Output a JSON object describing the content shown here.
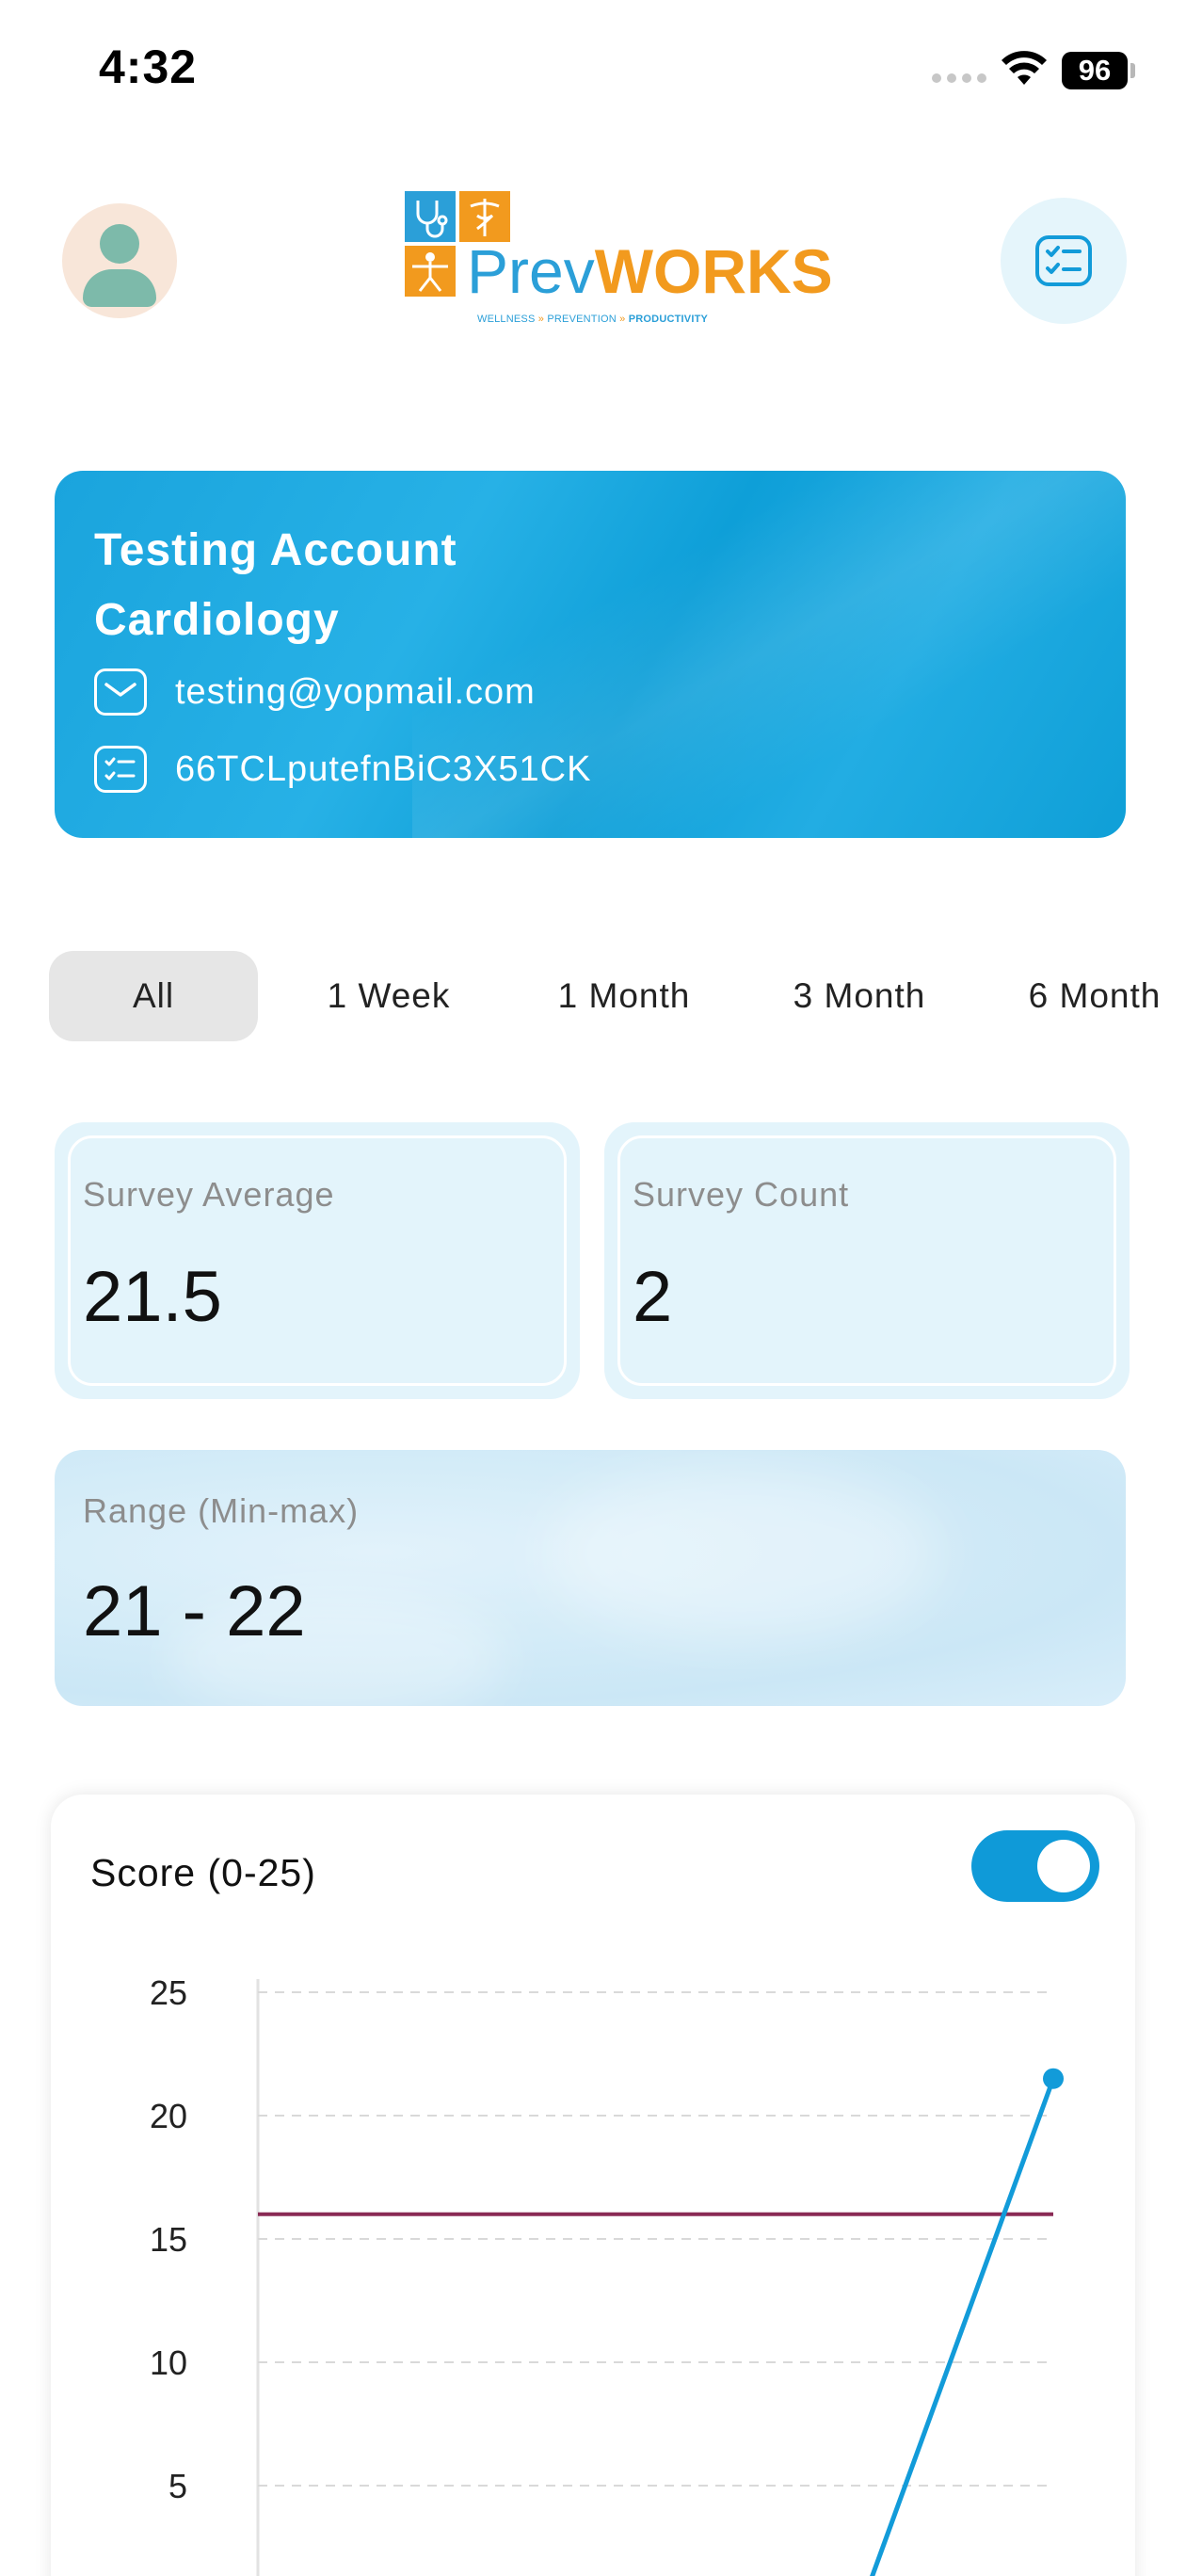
{
  "status_bar": {
    "time": "4:32",
    "battery": "96"
  },
  "header": {
    "logo": {
      "prev": "Prev",
      "works": "WORKS",
      "tagline": [
        "WELLNESS",
        "PREVENTION",
        "PRODUCTIVITY"
      ],
      "tagline_sep": "»"
    },
    "icons": {
      "avatar": "user-avatar",
      "survey": "checklist-icon"
    }
  },
  "account": {
    "name": "Testing Account Cardiology",
    "email": "testing@yopmail.com",
    "id": "66TCLputefnBiC3X51CK"
  },
  "filters": {
    "tabs": [
      "All",
      "1 Week",
      "1 Month",
      "3 Month",
      "6 Month"
    ],
    "active": "All"
  },
  "stats": {
    "average": {
      "label": "Survey Average",
      "value": "21.5"
    },
    "count": {
      "label": "Survey Count",
      "value": "2"
    },
    "range": {
      "label": "Range (Min-max)",
      "value": "21 - 22"
    }
  },
  "chart": {
    "title": "Score (0-25)",
    "toggle_on": true
  },
  "chart_data": {
    "type": "line",
    "title": "Score (0-25)",
    "ylim": [
      0,
      25
    ],
    "yticks": [
      25,
      20,
      15,
      10,
      5
    ],
    "grid": true,
    "threshold": 16,
    "series": [
      {
        "values": [
          21.5
        ]
      }
    ],
    "trend_line_from": 0,
    "colors": {
      "line": "#129bd9",
      "threshold": "#8a2a55",
      "grid": "#d9d9d9"
    }
  },
  "colors": {
    "accent": "#129bd9",
    "card_bg": "#e3f4fb",
    "tab_active_bg": "#e6e6e6"
  }
}
